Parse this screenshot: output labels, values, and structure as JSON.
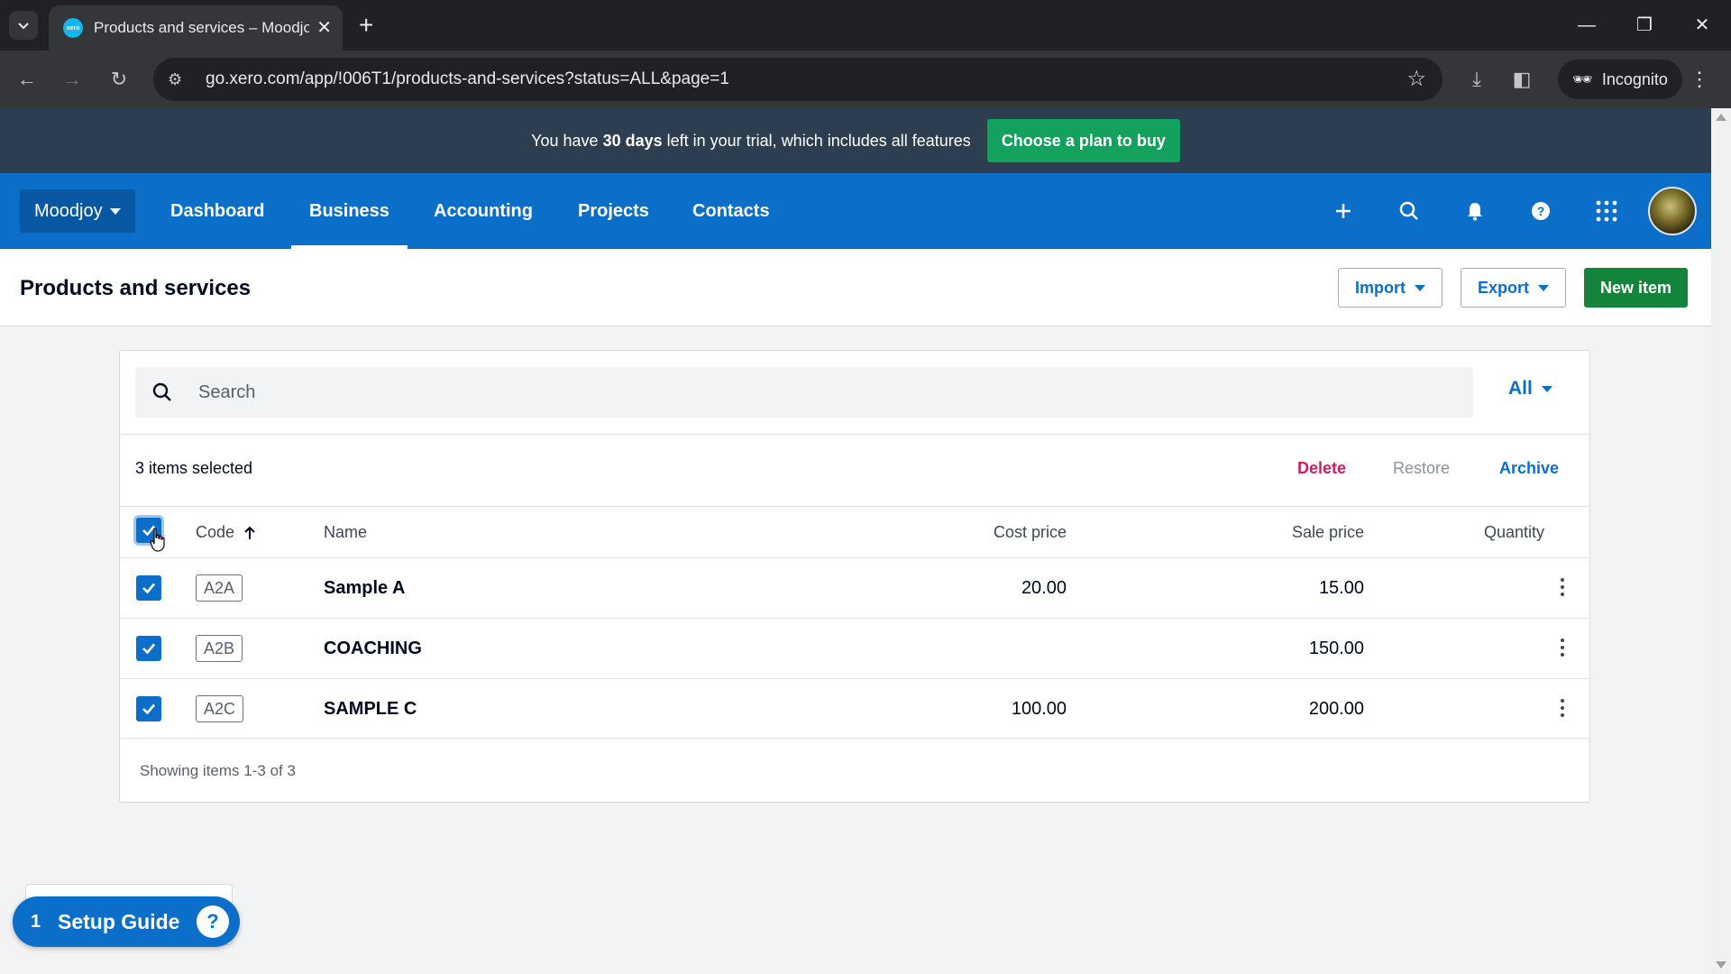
{
  "browser": {
    "tab_title": "Products and services – Moodjoy",
    "favicon_text": "xero",
    "url": "go.xero.com/app/!006T1/products-and-services?status=ALL&page=1",
    "incognito_label": "Incognito"
  },
  "trial_banner": {
    "prefix": "You have ",
    "days": "30 days",
    "suffix": " left in your trial, which includes all features",
    "cta": "Choose a plan to buy"
  },
  "nav": {
    "org": "Moodjoy",
    "links": [
      "Dashboard",
      "Business",
      "Accounting",
      "Projects",
      "Contacts"
    ],
    "active": "Business"
  },
  "page": {
    "title": "Products and services",
    "import_label": "Import",
    "export_label": "Export",
    "new_item_label": "New item"
  },
  "list": {
    "search_placeholder": "Search",
    "filter_label": "All",
    "selected_text": "3 items selected",
    "actions": {
      "delete": "Delete",
      "restore": "Restore",
      "archive": "Archive"
    },
    "columns": {
      "code": "Code",
      "name": "Name",
      "cost": "Cost price",
      "sale": "Sale price",
      "quantity": "Quantity"
    },
    "rows": [
      {
        "code": "A2A",
        "name": "Sample A",
        "cost": "20.00",
        "sale": "15.00",
        "quantity": ""
      },
      {
        "code": "A2B",
        "name": "COACHING",
        "cost": "",
        "sale": "150.00",
        "quantity": ""
      },
      {
        "code": "A2C",
        "name": "SAMPLE C",
        "cost": "100.00",
        "sale": "200.00",
        "quantity": ""
      }
    ],
    "footer": "Showing items 1-3 of 3"
  },
  "setup_guide": {
    "count": "1",
    "label": "Setup Guide"
  },
  "colors": {
    "brand_blue": "#0b6fca",
    "green": "#14843c",
    "delete_red": "#cb1e5e",
    "banner": "#2c3e50"
  }
}
